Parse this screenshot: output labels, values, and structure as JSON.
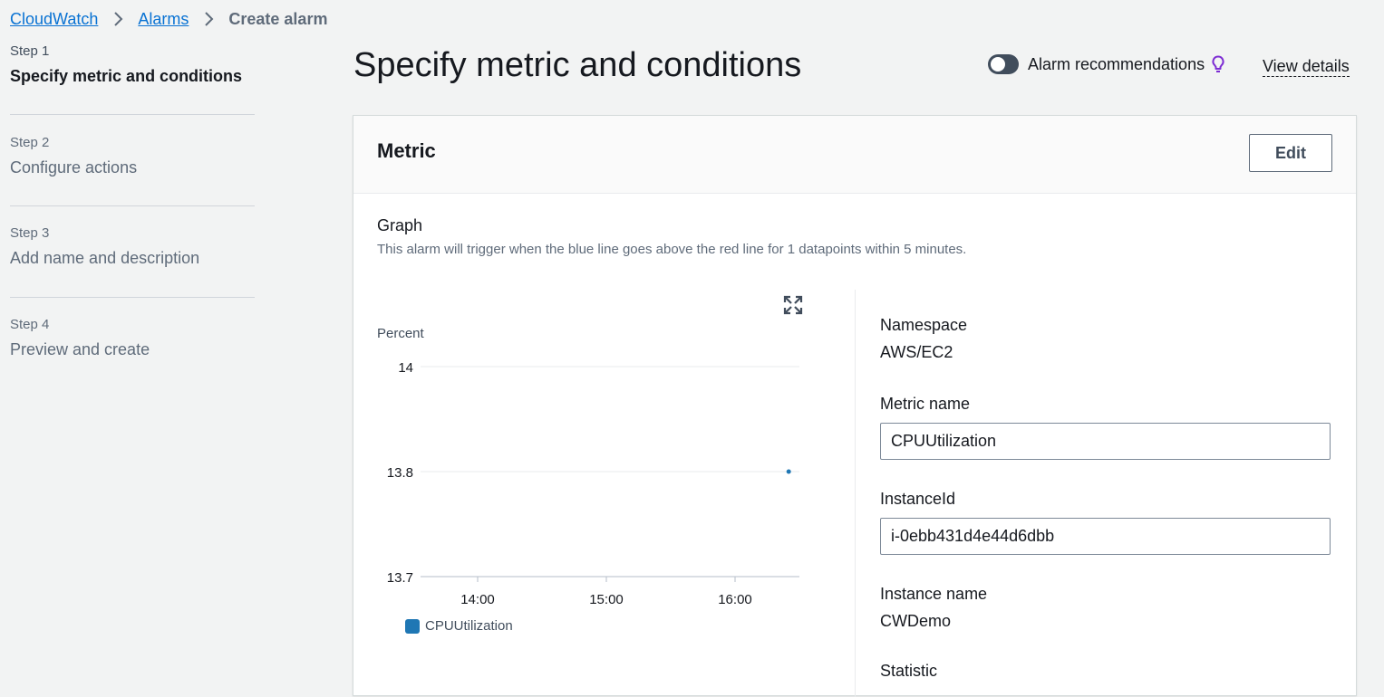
{
  "breadcrumb": {
    "items": [
      "CloudWatch",
      "Alarms"
    ],
    "current": "Create alarm"
  },
  "steps": [
    {
      "num": "Step 1",
      "title": "Specify metric and conditions"
    },
    {
      "num": "Step 2",
      "title": "Configure actions"
    },
    {
      "num": "Step 3",
      "title": "Add name and description"
    },
    {
      "num": "Step 4",
      "title": "Preview and create"
    }
  ],
  "header": {
    "title": "Specify metric and conditions",
    "recommendations_label": "Alarm recommendations",
    "recommendations_enabled": false,
    "view_details": "View details"
  },
  "metric": {
    "title": "Metric",
    "edit_label": "Edit",
    "graph_label": "Graph",
    "graph_description": "This alarm will trigger when the blue line goes above the red line for 1 datapoints within 5 minutes."
  },
  "chart_data": {
    "type": "line",
    "ylabel": "Percent",
    "yticks": [
      14,
      13.8,
      13.7
    ],
    "ytick_labels": [
      "14",
      "13.8",
      "13.7"
    ],
    "xticks": [
      "14:00",
      "15:00",
      "16:00"
    ],
    "series": [
      {
        "name": "CPUUtilization",
        "color": "#1f77b4",
        "points": [
          {
            "x": "16:25",
            "y": 13.8
          }
        ]
      }
    ]
  },
  "details": {
    "namespace_label": "Namespace",
    "namespace_value": "AWS/EC2",
    "metric_name_label": "Metric name",
    "metric_name_value": "CPUUtilization",
    "instance_id_label": "InstanceId",
    "instance_id_value": "i-0ebb431d4e44d6dbb",
    "instance_name_label": "Instance name",
    "instance_name_value": "CWDemo",
    "statistic_label": "Statistic"
  },
  "colors": {
    "link": "#0972d3",
    "series": "#1f77b4",
    "background": "#f2f3f3"
  }
}
